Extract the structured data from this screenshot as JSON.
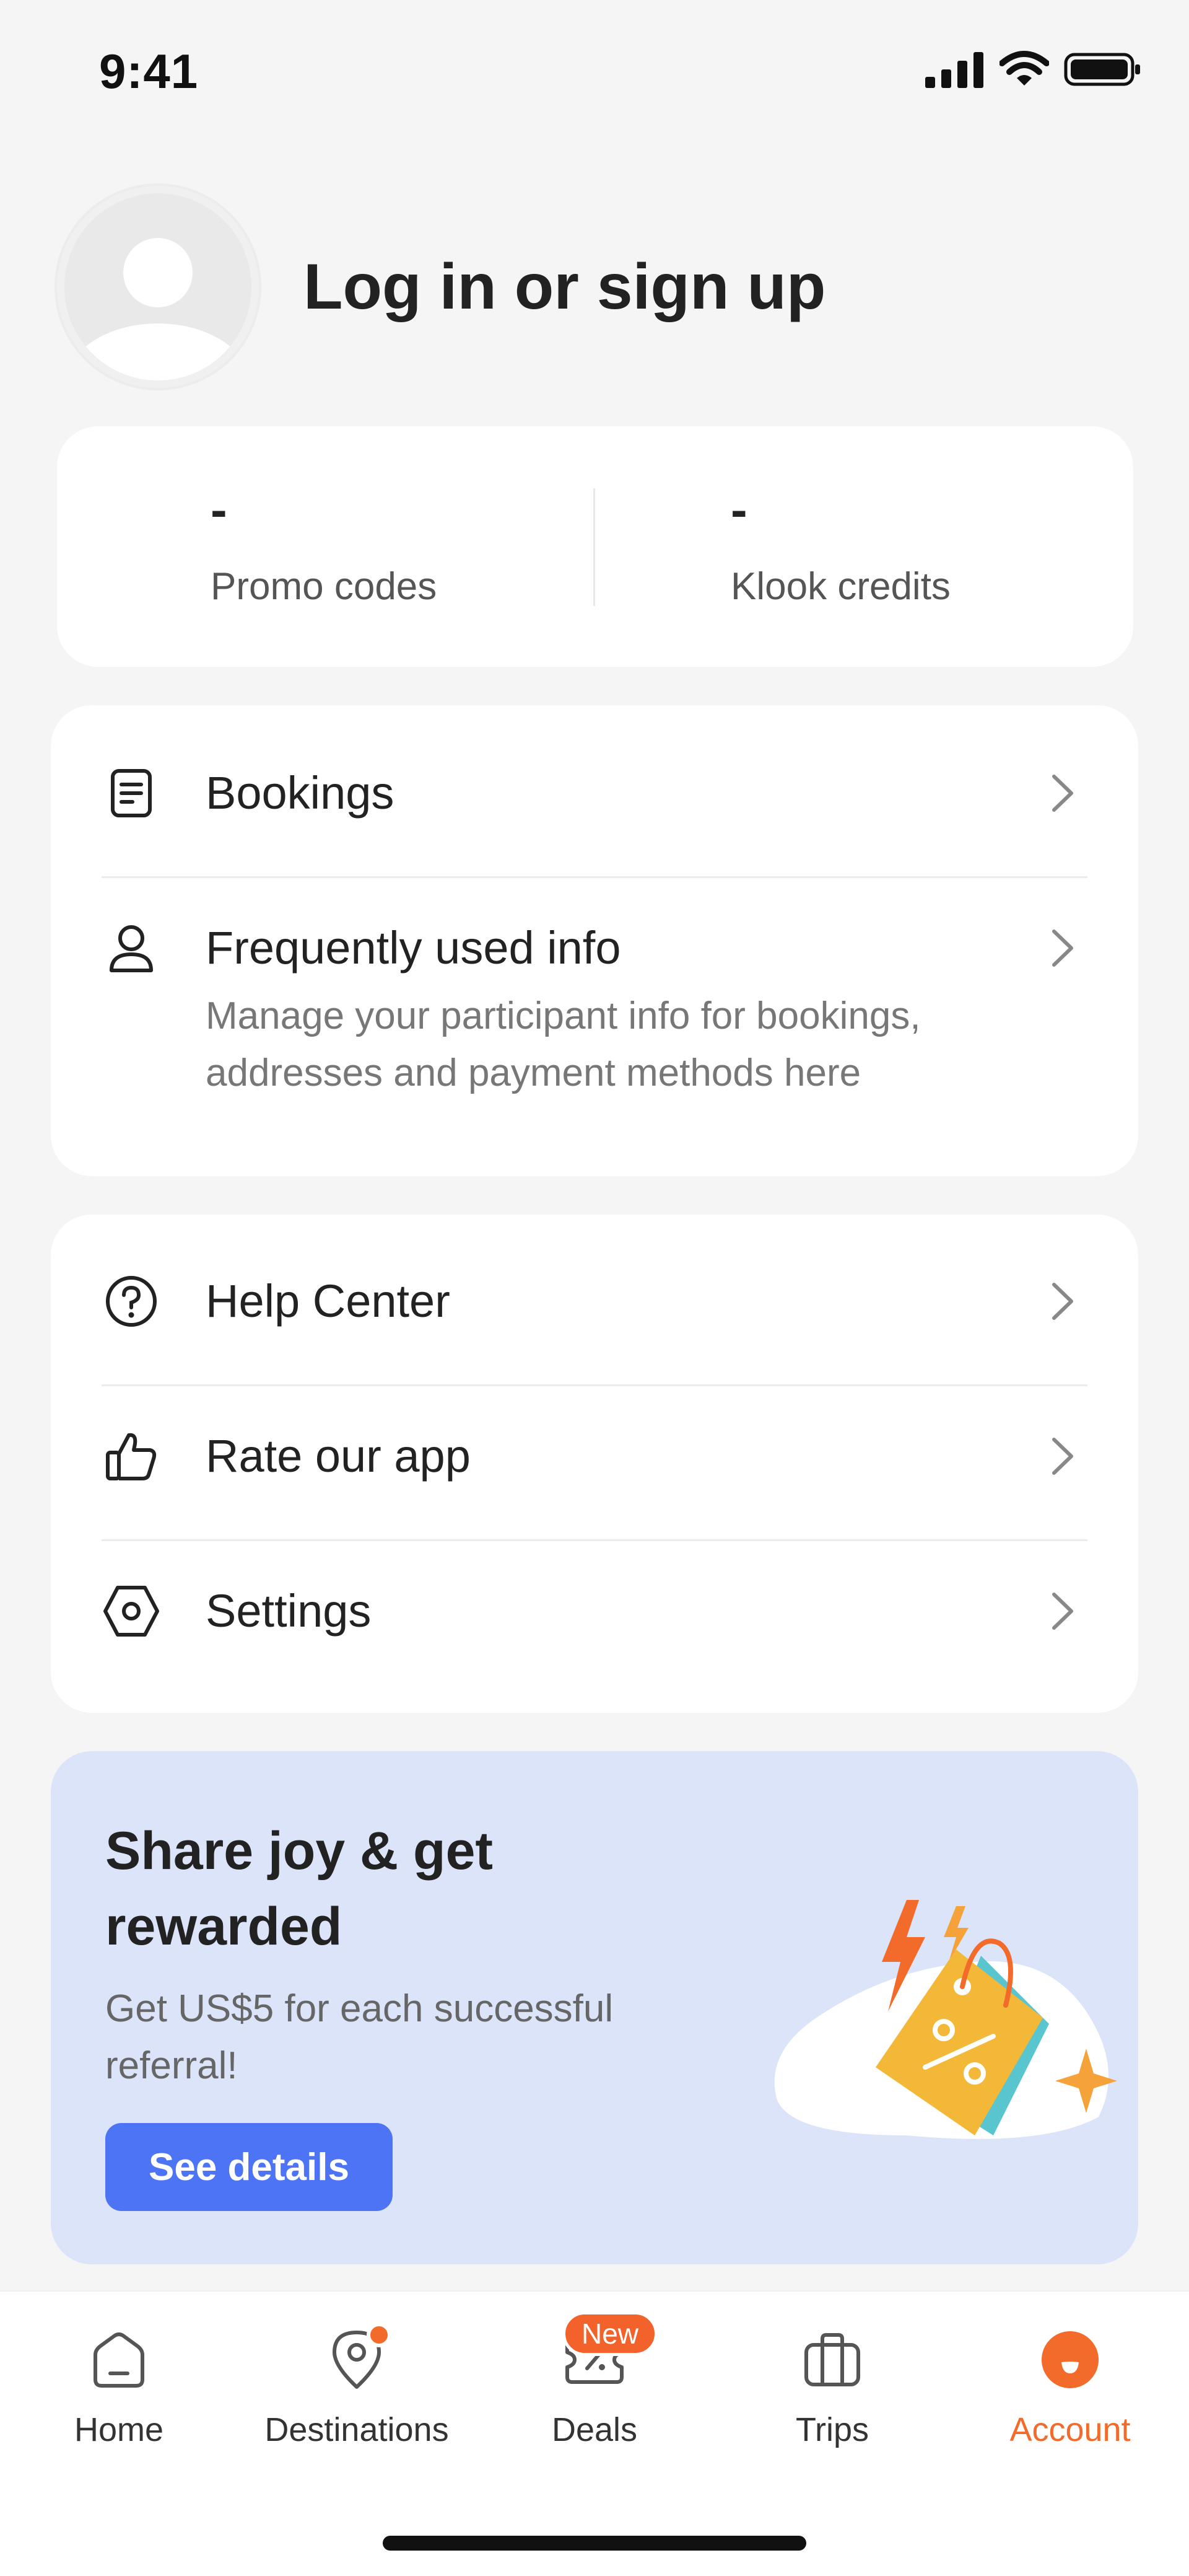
{
  "status_bar": {
    "time": "9:41",
    "icons": [
      "signal-icon",
      "wifi-icon",
      "battery-icon"
    ]
  },
  "profile": {
    "title": "Log in or sign up",
    "avatar_icon": "default-avatar-icon"
  },
  "stats": {
    "promo": {
      "value": "-",
      "label": "Promo codes"
    },
    "credits": {
      "value": "-",
      "label": "Klook credits"
    }
  },
  "menu_primary": [
    {
      "label": "Bookings",
      "icon": "document-icon"
    },
    {
      "label": "Frequently used info",
      "sub": "Manage your participant info for bookings, addresses and payment methods here",
      "icon": "person-icon"
    }
  ],
  "menu_secondary": [
    {
      "label": "Help Center",
      "icon": "question-circle-icon"
    },
    {
      "label": "Rate our app",
      "icon": "thumbs-up-icon"
    },
    {
      "label": "Settings",
      "icon": "settings-hexagon-icon"
    }
  ],
  "referral": {
    "title": "Share joy & get rewarded",
    "subtitle": "Get US$5 for each successful referral!",
    "button": "See details",
    "art_icon": "discount-tag-illustration"
  },
  "bottom_nav": {
    "items": [
      {
        "label": "Home",
        "icon": "home-icon"
      },
      {
        "label": "Destinations",
        "icon": "location-pin-icon"
      },
      {
        "label": "Deals",
        "icon": "ticket-percent-icon",
        "badge": "New"
      },
      {
        "label": "Trips",
        "icon": "suitcase-icon"
      },
      {
        "label": "Account",
        "icon": "account-icon"
      }
    ],
    "active": "Account"
  },
  "colors": {
    "accent": "#f26b2a",
    "primary_button": "#4c74f4",
    "referral_bg": "#dce4fa",
    "page_bg": "#f5f5f5"
  }
}
